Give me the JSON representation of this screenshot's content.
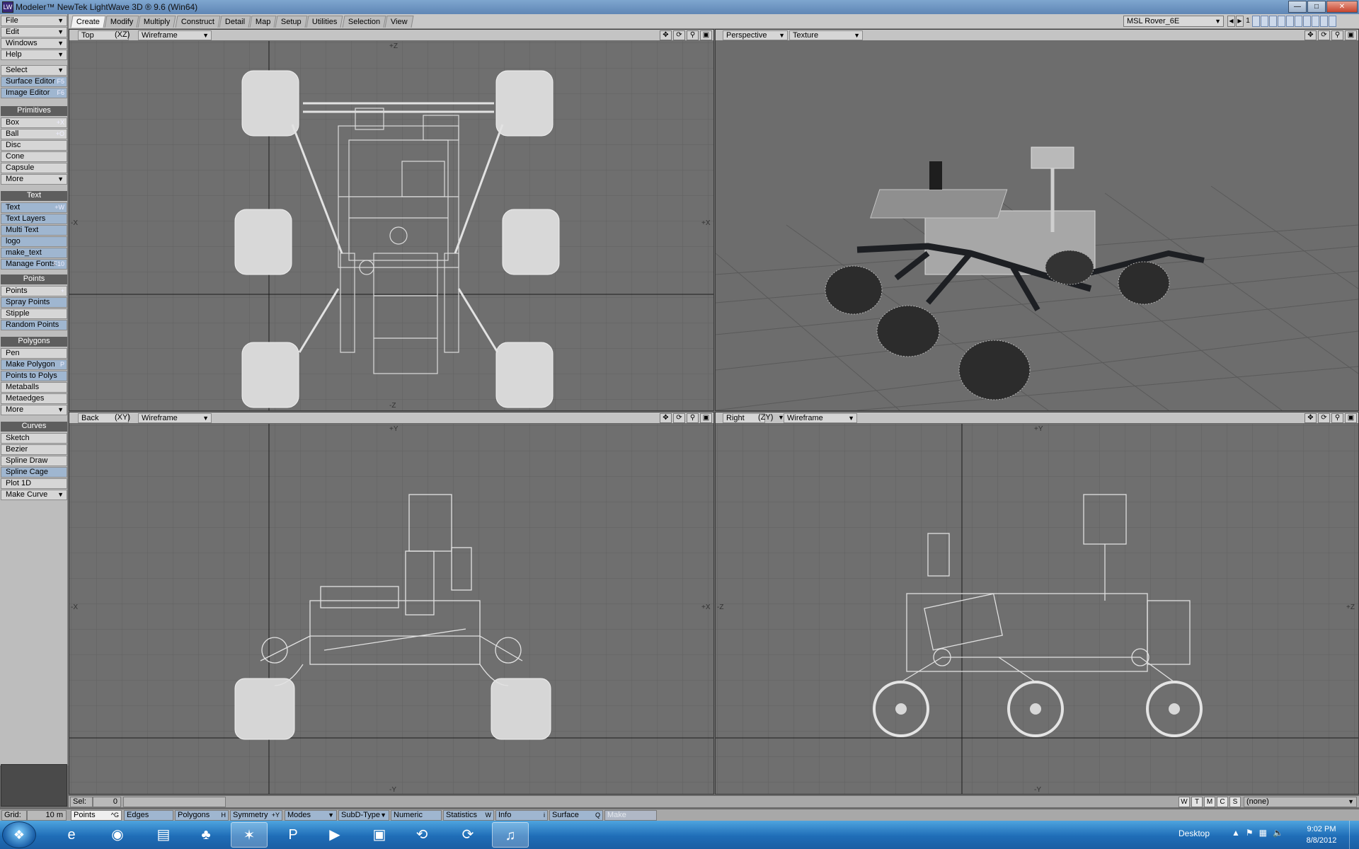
{
  "window": {
    "title": "Modeler™ NewTek LightWave 3D ® 9.6  (Win64)",
    "icon": "lightwave-app-icon"
  },
  "menus": [
    {
      "label": "File"
    },
    {
      "label": "Edit"
    },
    {
      "label": "Windows"
    },
    {
      "label": "Help"
    }
  ],
  "tabs": [
    "Create",
    "Modify",
    "Multiply",
    "Construct",
    "Detail",
    "Map",
    "Setup",
    "Utilities",
    "Selection",
    "View"
  ],
  "active_tab": "Create",
  "object_select": "MSL Rover_6E",
  "layer_number": "1",
  "toolbar": {
    "select": "Select",
    "surface_editor": {
      "label": "Surface Editor",
      "shortcut": "F5"
    },
    "image_editor": {
      "label": "Image Editor",
      "shortcut": "F6"
    },
    "primitives_header": "Primitives",
    "primitives": [
      {
        "label": "Box",
        "shortcut": "+X"
      },
      {
        "label": "Ball",
        "shortcut": "+O"
      },
      {
        "label": "Disc",
        "shortcut": ""
      },
      {
        "label": "Cone",
        "shortcut": ""
      },
      {
        "label": "Capsule",
        "shortcut": ""
      },
      {
        "label": "More",
        "shortcut": ""
      }
    ],
    "text_header": "Text",
    "text_items": [
      {
        "label": "Text",
        "shortcut": "+W"
      },
      {
        "label": "Text Layers",
        "shortcut": ""
      },
      {
        "label": "Multi Text",
        "shortcut": ""
      },
      {
        "label": "logo",
        "shortcut": ""
      },
      {
        "label": "make_text",
        "shortcut": ""
      },
      {
        "label": "Manage Fonts",
        "shortcut": "F10"
      }
    ],
    "points_header": "Points",
    "points_items": [
      {
        "label": "Points",
        "shortcut": "+"
      },
      {
        "label": "Spray Points",
        "shortcut": ""
      },
      {
        "label": "Stipple",
        "shortcut": ""
      },
      {
        "label": "Random Points",
        "shortcut": ""
      }
    ],
    "polygons_header": "Polygons",
    "polygons_items": [
      {
        "label": "Pen",
        "shortcut": ""
      },
      {
        "label": "Make Polygon",
        "shortcut": "P"
      },
      {
        "label": "Points to Polys",
        "shortcut": ""
      },
      {
        "label": "Metaballs",
        "shortcut": ""
      },
      {
        "label": "Metaedges",
        "shortcut": ""
      },
      {
        "label": "More",
        "shortcut": ""
      }
    ],
    "curves_header": "Curves",
    "curves_items": [
      {
        "label": "Sketch",
        "shortcut": ""
      },
      {
        "label": "Bezier",
        "shortcut": ""
      },
      {
        "label": "Spline Draw",
        "shortcut": ""
      },
      {
        "label": "Spline Cage",
        "shortcut": ""
      },
      {
        "label": "Plot 1D",
        "shortcut": ""
      },
      {
        "label": "Make Curve",
        "shortcut": ""
      }
    ]
  },
  "viewports": {
    "top": {
      "view": "Top",
      "axes": "(XZ)",
      "mode": "Wireframe",
      "axis_top": "+Z",
      "axis_bottom": "-Z",
      "axis_left": "-X",
      "axis_right": "+X"
    },
    "perspective": {
      "view": "Perspective",
      "mode": "Texture"
    },
    "back": {
      "view": "Back",
      "axes": "(XY)",
      "mode": "Wireframe",
      "axis_top": "+Y",
      "axis_bottom": "-Y",
      "axis_left": "-X",
      "axis_right": "+X"
    },
    "right": {
      "view": "Right",
      "axes": "(ZY)",
      "mode": "Wireframe",
      "axis_top": "+Y",
      "axis_bottom": "-Y",
      "axis_left": "-Z",
      "axis_right": "+Z"
    }
  },
  "status": {
    "sel_label": "Sel:",
    "sel_value": "0",
    "grid_label": "Grid:",
    "grid_value": "10 m",
    "wtmcs": [
      "W",
      "T",
      "M",
      "C",
      "S"
    ],
    "surface_value": "(none)",
    "modes_row": [
      {
        "label": "Points",
        "shortcut": "^G"
      },
      {
        "label": "Edges",
        "shortcut": ""
      },
      {
        "label": "Polygons",
        "shortcut": "H"
      },
      {
        "label": "Symmetry",
        "shortcut": "+Y"
      },
      {
        "label": "Modes",
        "shortcut": ""
      },
      {
        "label": "SubD-Type",
        "shortcut": ""
      },
      {
        "label": "Numeric",
        "shortcut": ""
      },
      {
        "label": "Statistics",
        "shortcut": "W"
      },
      {
        "label": "Info",
        "shortcut": "i"
      },
      {
        "label": "Surface",
        "shortcut": "Q"
      },
      {
        "label": "Make",
        "shortcut": ""
      }
    ]
  },
  "taskbar": {
    "apps": [
      "windows-explorer-icon",
      "internet-explorer-icon",
      "firefox-icon",
      "folder-icon",
      "acrobat-icon",
      "lightwave-modeler-icon",
      "powerpoint-icon",
      "media-player-icon",
      "network-icon",
      "lightwave-layout-icon",
      "lightwave-hub-icon",
      "itunes-icon"
    ],
    "desktop_label": "Desktop",
    "time": "9:02 PM",
    "date": "8/8/2012"
  }
}
